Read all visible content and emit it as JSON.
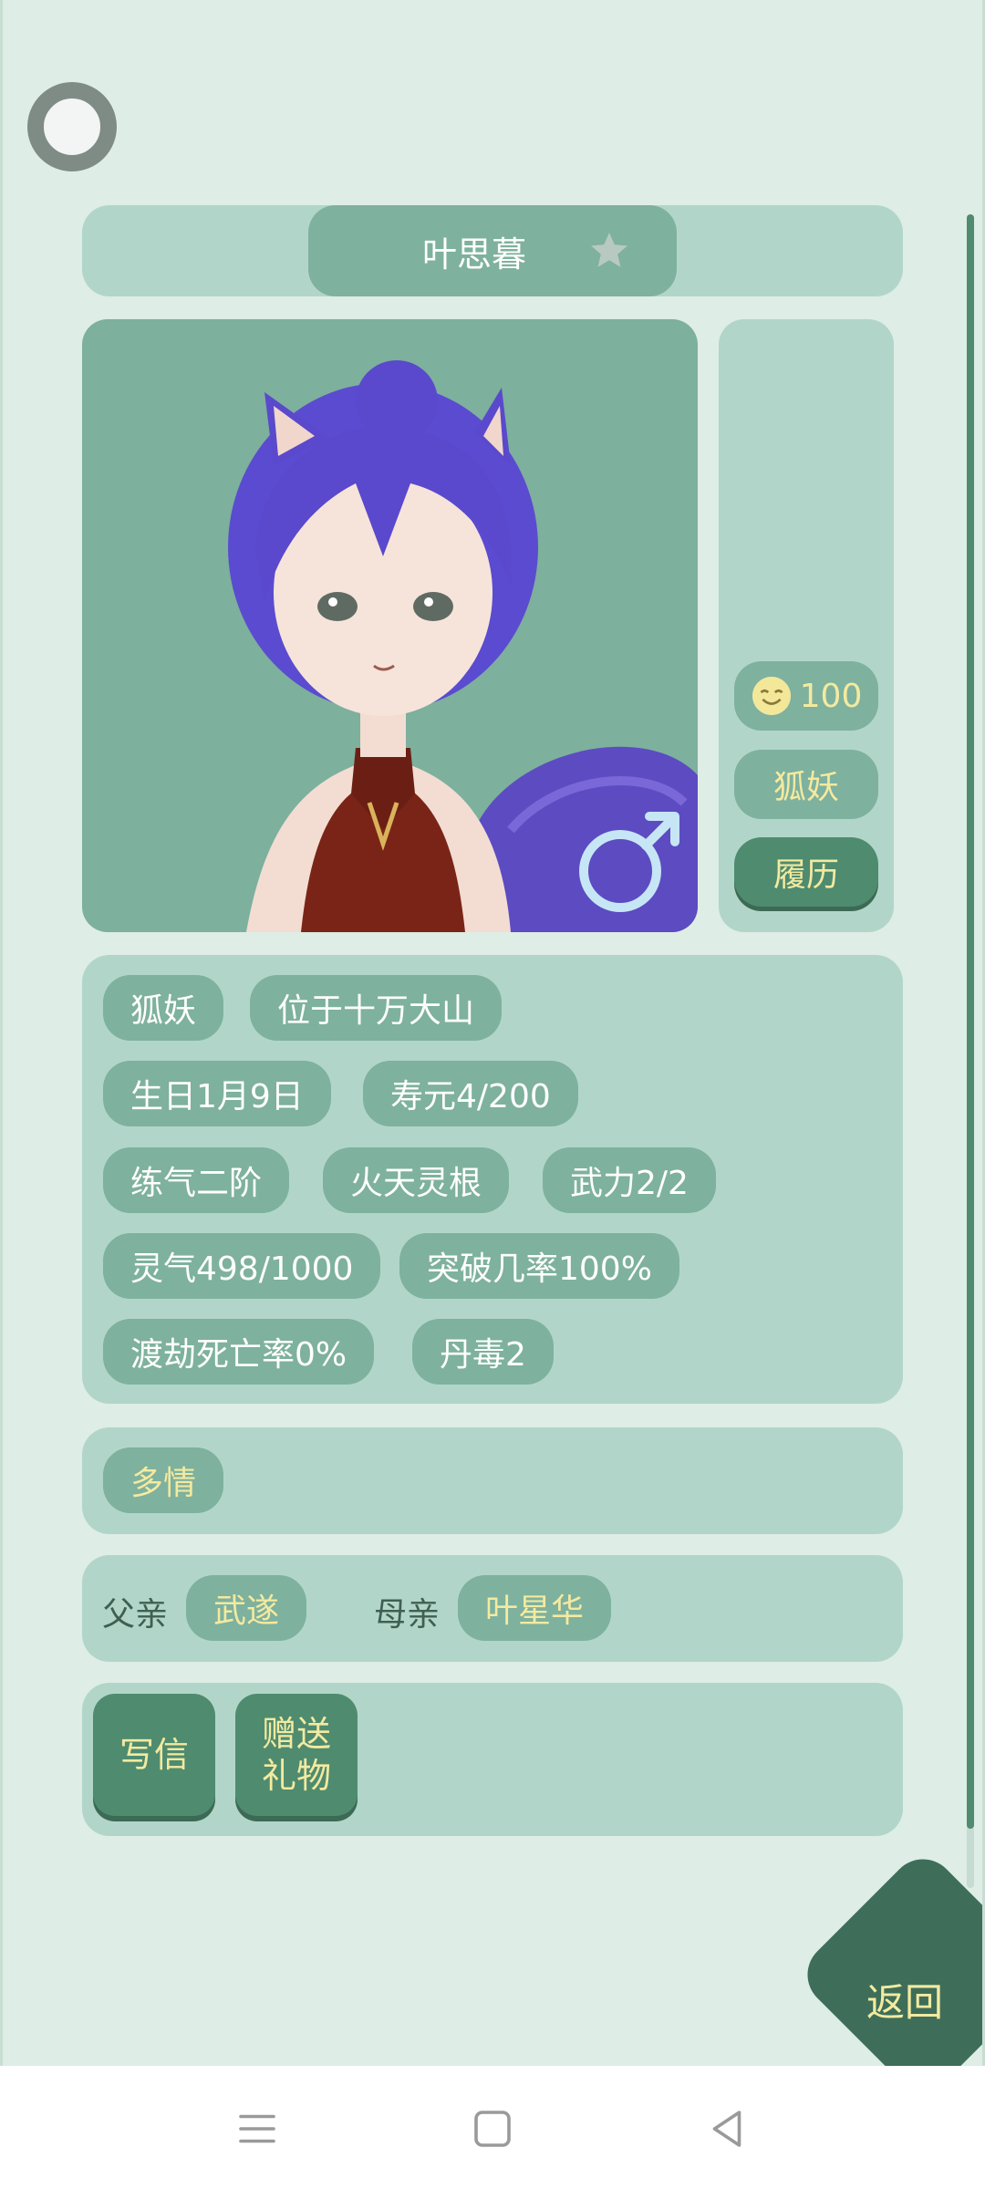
{
  "character": {
    "name": "叶思暮",
    "gender_symbol": "♂"
  },
  "side": {
    "mood_value": "100",
    "race_label": "狐妖",
    "history_label": "履历"
  },
  "info_tags": [
    "狐妖",
    "位于十万大山",
    "生日1月9日",
    "寿元4/200",
    "练气二阶",
    "火天灵根",
    "武力2/2",
    "灵气498/1000",
    "突破几率100%",
    "渡劫死亡率0%",
    "丹毒2"
  ],
  "trait": "多情",
  "family": {
    "father_label": "父亲",
    "father_name": "武遂",
    "mother_label": "母亲",
    "mother_name": "叶星华"
  },
  "actions": {
    "write_letter": "写信",
    "gift_line1": "赠送",
    "gift_line2": "礼物"
  },
  "back_label": "返回",
  "colors": {
    "background": "#deede6",
    "panel": "#b1d6c9",
    "pill": "#7eb19e",
    "button_dark": "#4f8b6f",
    "accent_text": "#f3eaa0"
  }
}
